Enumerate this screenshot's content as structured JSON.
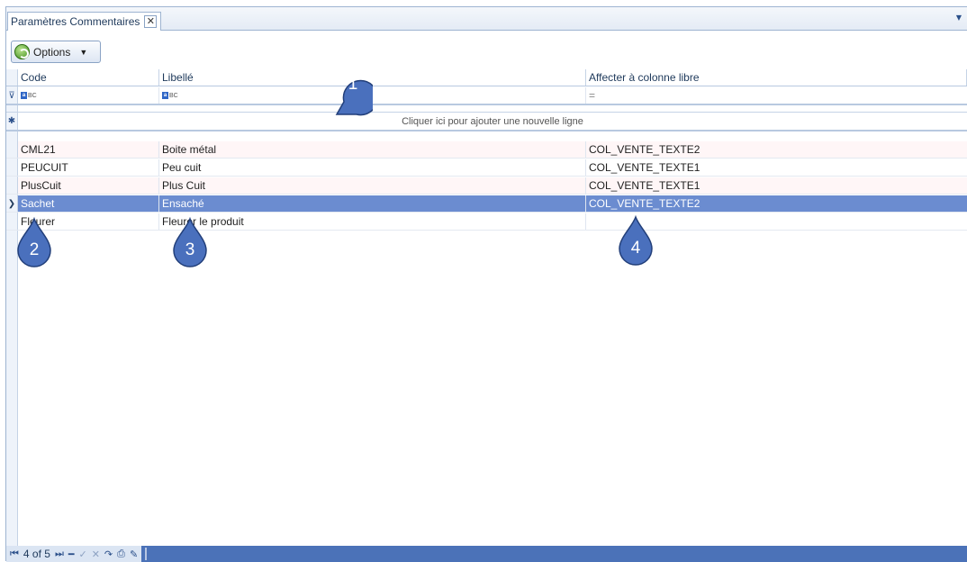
{
  "tab": {
    "title": "Paramètres Commentaires",
    "close_glyph": "✕"
  },
  "toolbar": {
    "options_label": "Options"
  },
  "grid": {
    "columns": [
      "Code",
      "Libellé",
      "Affecter à colonne libre"
    ],
    "filter_affect": "=",
    "new_row_text": "Cliquer ici pour ajouter une nouvelle ligne",
    "rows": [
      {
        "code": "CML21",
        "libelle": "Boite métal",
        "affecter": "COL_VENTE_TEXTE2"
      },
      {
        "code": "PEUCUIT",
        "libelle": "Peu cuit",
        "affecter": "COL_VENTE_TEXTE1"
      },
      {
        "code": "PlusCuit",
        "libelle": "Plus Cuit",
        "affecter": "COL_VENTE_TEXTE1"
      },
      {
        "code": "Sachet",
        "libelle": "Ensaché",
        "affecter": "COL_VENTE_TEXTE2"
      },
      {
        "code": "Fleurer",
        "libelle": "Fleurer le produit",
        "affecter": ""
      }
    ],
    "selected_row": 3
  },
  "navigator": {
    "position_text": "4 of 5"
  },
  "callouts": [
    "1",
    "2",
    "3",
    "4"
  ],
  "colors": {
    "accent": "#4b72b8",
    "selection": "#6b8cd0",
    "callout": "#4a70bd"
  }
}
